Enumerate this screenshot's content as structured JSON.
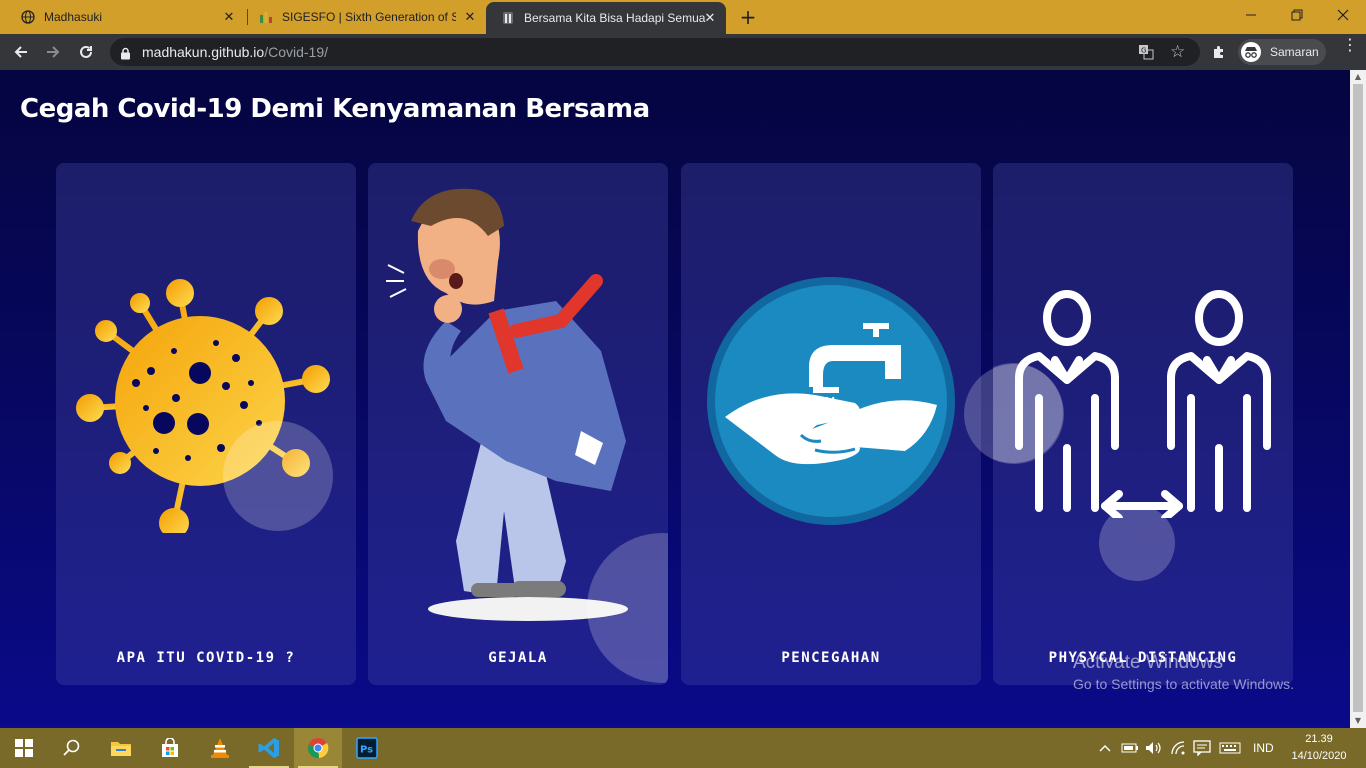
{
  "browser": {
    "tabs": [
      {
        "title": "Madhasuki",
        "icon": "globe-icon"
      },
      {
        "title": "SIGESFO | Sixth Generation of SIS",
        "icon": "sigesfo-favicon-icon"
      },
      {
        "title": "Bersama Kita Bisa Hadapi Semua",
        "icon": "page-favicon-icon"
      }
    ],
    "active_tab": 2,
    "url_host": "madhakun.github.io",
    "url_path": "/Covid-19/",
    "profile_label": "Samaran",
    "colors": {
      "frame": "#d39f2b",
      "toolbar": "#35363a"
    }
  },
  "page": {
    "title": "Cegah Covid-19 Demi Kenyamanan Bersama",
    "cards": [
      {
        "label": "APA ITU COVID-19 ?",
        "illustration": "virus-icon"
      },
      {
        "label": "GEJALA",
        "illustration": "coughing-man-icon"
      },
      {
        "label": "PENCEGAHAN",
        "illustration": "handwashing-icon"
      },
      {
        "label": "PHYSYCAL DISTANCING",
        "illustration": "physical-distancing-icon"
      }
    ],
    "colors": {
      "background": "#07075e",
      "virus": "#f7b90f",
      "handwash_circle": "#1a8ac0"
    }
  },
  "watermark": {
    "line1": "Activate Windows",
    "line2": "Go to Settings to activate Windows."
  },
  "taskbar": {
    "apps": [
      "start-icon",
      "search-icon",
      "file-explorer-icon",
      "store-icon",
      "vlc-icon",
      "vscode-icon",
      "chrome-icon",
      "photoshop-icon"
    ],
    "language": "IND",
    "time": "21.39",
    "date": "14/10/2020"
  }
}
